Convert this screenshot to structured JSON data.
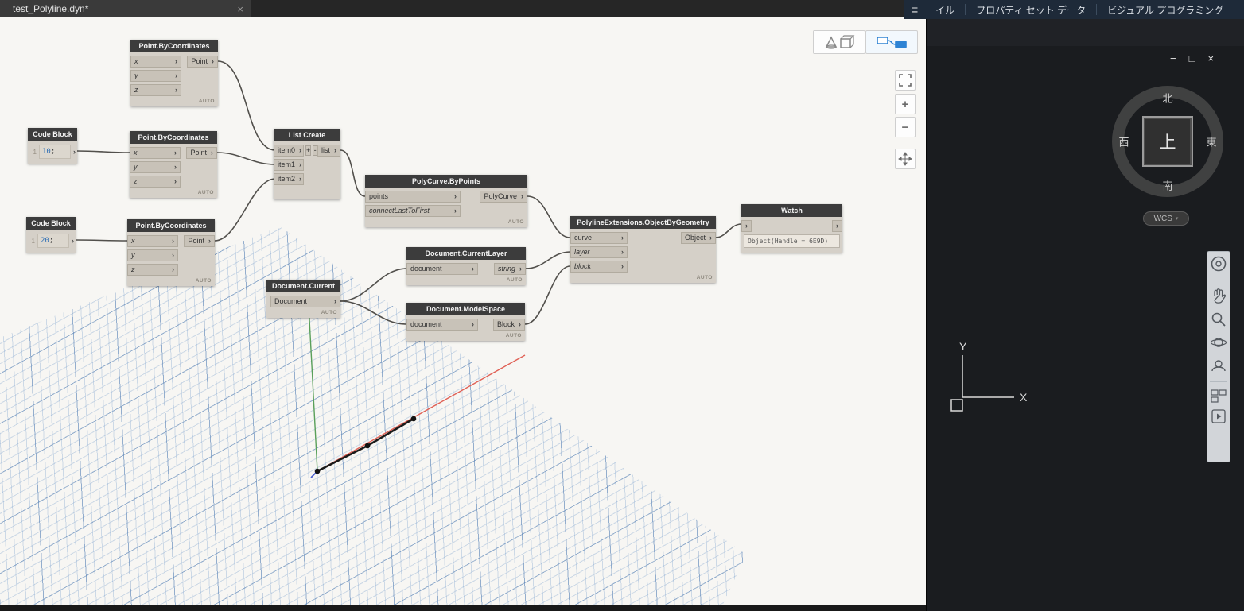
{
  "dynamo": {
    "tab": {
      "title": "test_Polyline.dyn*",
      "close_icon": "×"
    },
    "icons": {
      "port_arrow": "›"
    },
    "canvas_controls": {
      "zoom_in": "+",
      "zoom_out": "−"
    },
    "node_defs": {
      "point_by_coordinates": {
        "title": "Point.ByCoordinates",
        "inputs": [
          "x",
          "y",
          "z"
        ],
        "output": "Point",
        "lacing": "AUTO"
      },
      "code_block": {
        "title": "Code Block",
        "blocks": [
          {
            "line": "1",
            "num": "10",
            "suffix": ";"
          },
          {
            "line": "1",
            "num": "20",
            "suffix": ";"
          }
        ]
      },
      "list_create": {
        "title": "List Create",
        "inputs": [
          "item0",
          "item1",
          "item2"
        ],
        "output": "list",
        "add": "+",
        "remove": "-"
      },
      "polycurve_by_points": {
        "title": "PolyCurve.ByPoints",
        "inputs": [
          "points",
          "connectLastToFirst"
        ],
        "output": "PolyCurve",
        "lacing": "AUTO"
      },
      "document_current_layer": {
        "title": "Document.CurrentLayer",
        "inputs": [
          "document"
        ],
        "output": "string",
        "lacing": "AUTO"
      },
      "document_current": {
        "title": "Document.Current",
        "output": "Document",
        "lacing": "AUTO"
      },
      "document_model_space": {
        "title": "Document.ModelSpace",
        "inputs": [
          "document"
        ],
        "output": "Block",
        "lacing": "AUTO"
      },
      "polyline_extensions": {
        "title": "PolylineExtensions.ObjectByGeometry",
        "inputs": [
          "curve",
          "layer",
          "block"
        ],
        "output": "Object",
        "lacing": "AUTO"
      },
      "watch": {
        "title": "Watch",
        "value": "Object(Handle = 6E9D)"
      }
    }
  },
  "autocad": {
    "menu_icon": "≡",
    "ribbon_tabs": [
      {
        "label": "イル"
      },
      {
        "label": "プロパティ セット データ"
      },
      {
        "label": "ビジュアル プログラミング"
      }
    ],
    "window_controls": {
      "minimize": "−",
      "restore": "□",
      "close": "×"
    },
    "viewcube": {
      "north": "北",
      "south": "南",
      "west": "西",
      "east": "東",
      "top": "上"
    },
    "wcs_label": "WCS",
    "icons": {
      "dropdown_arrow": "▾"
    },
    "ucs": {
      "x": "X",
      "y": "Y"
    }
  }
}
